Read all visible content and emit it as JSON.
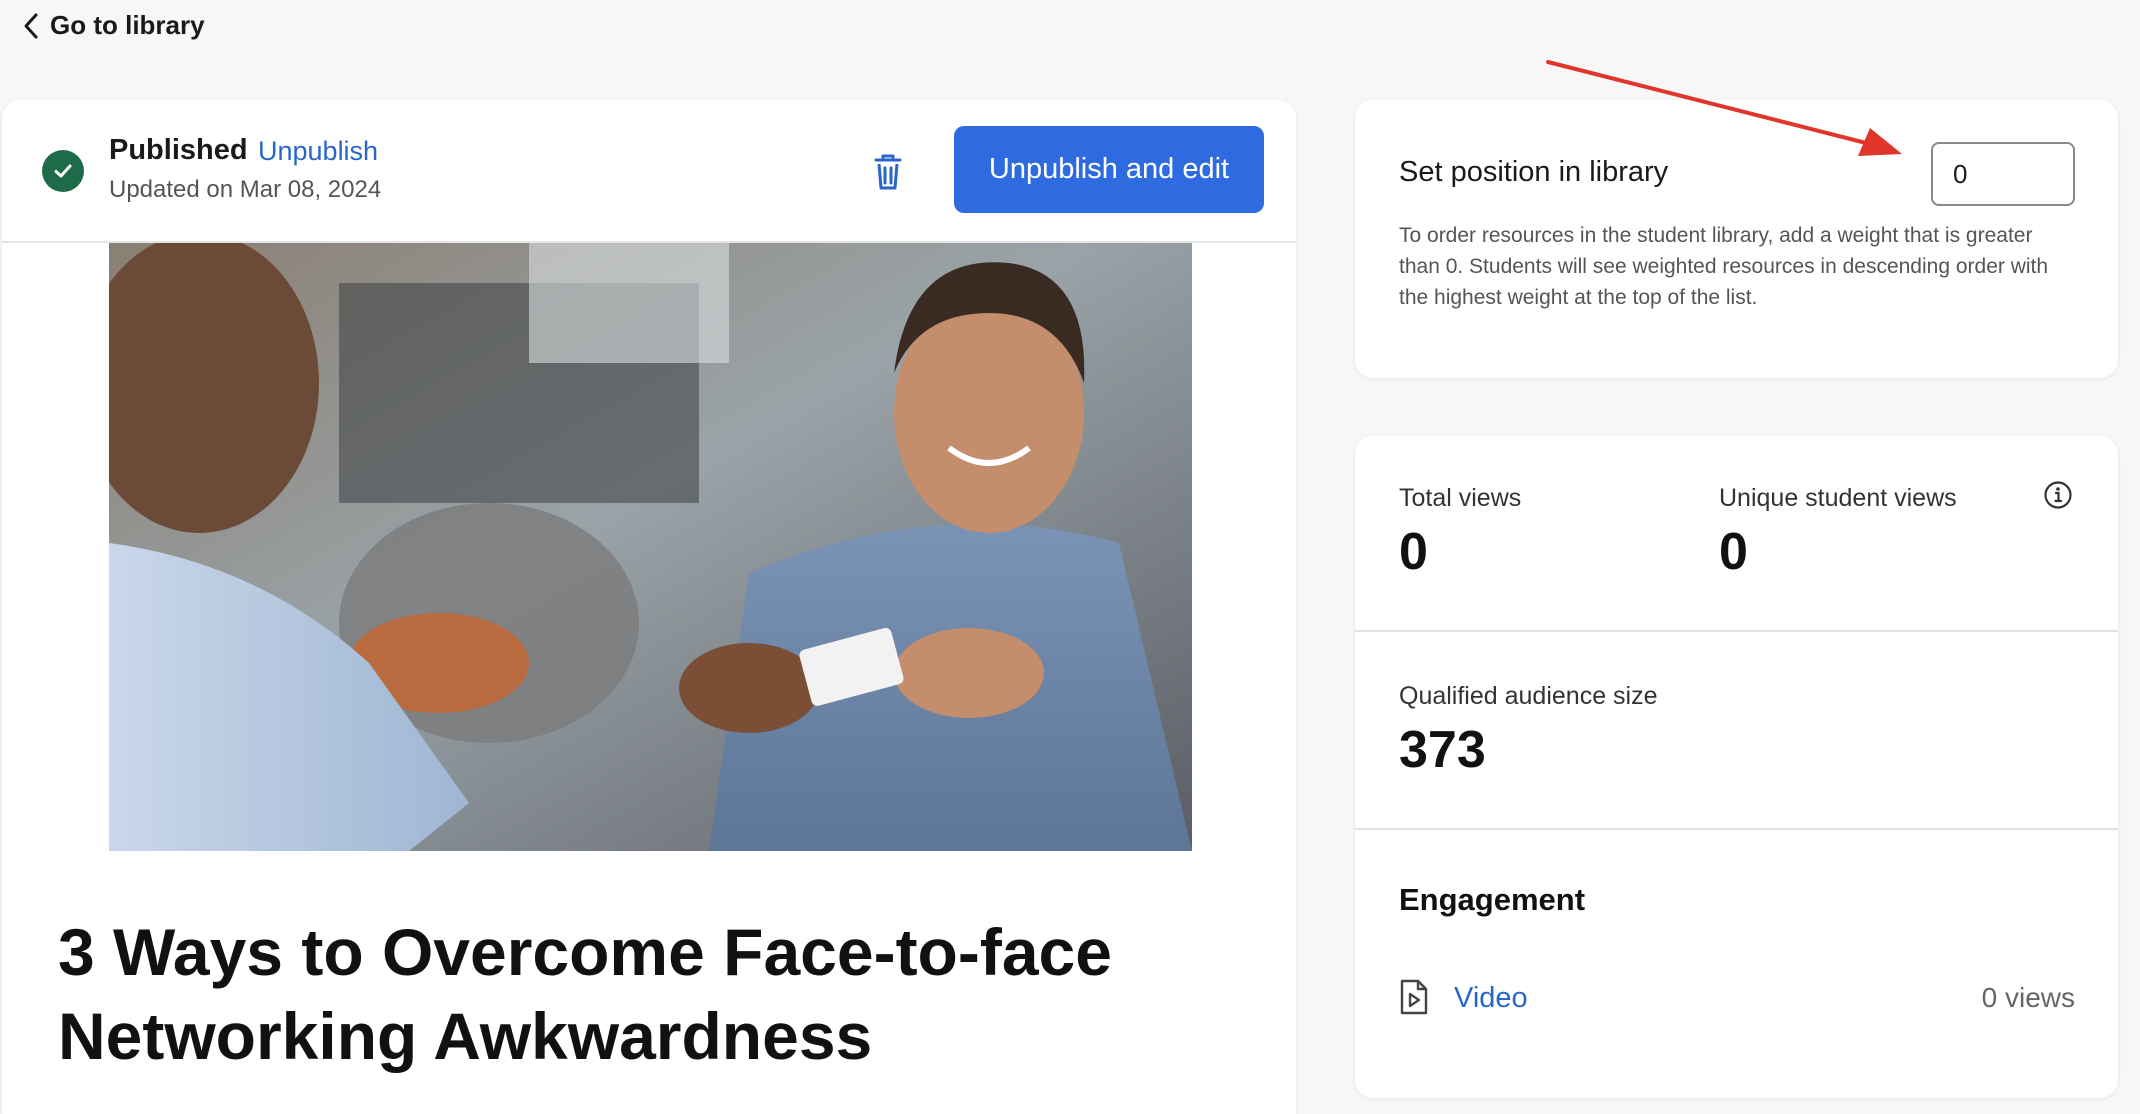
{
  "nav": {
    "back_label": "Go to library"
  },
  "status": {
    "title": "Published",
    "unpublish_label": "Unpublish",
    "updated": "Updated on Mar 08, 2024",
    "primary_button": "Unpublish and edit"
  },
  "article": {
    "title": "3 Ways to Overcome Face-to-face Networking Awkwardness",
    "hero_image": "two-men-exchanging-business-card-photo"
  },
  "position": {
    "title": "Set position in library",
    "value": "0",
    "description": "To order resources in the student library, add a weight that is greater than 0. Students will see weighted resources in descending order with the highest weight at the top of the list."
  },
  "stats": {
    "total_views_label": "Total views",
    "total_views_value": "0",
    "unique_views_label": "Unique student views",
    "unique_views_value": "0",
    "audience_label": "Qualified audience size",
    "audience_value": "373"
  },
  "engagement": {
    "title": "Engagement",
    "items": [
      {
        "label": "Video",
        "views": "0 views",
        "icon": "video-file-icon"
      }
    ]
  },
  "colors": {
    "accent": "#2f6be0",
    "link": "#2a66c9",
    "success": "#1e6b4a",
    "annotation": "#e0352b"
  }
}
